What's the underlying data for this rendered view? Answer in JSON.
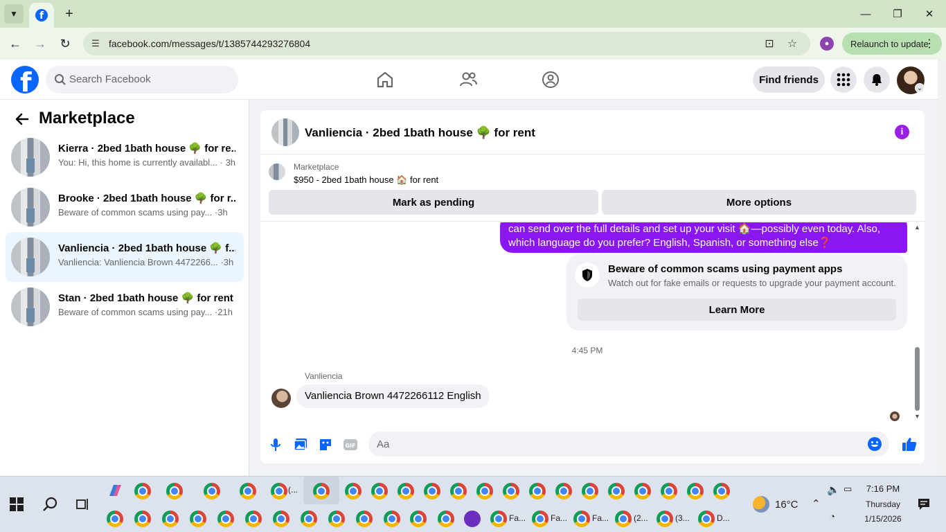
{
  "browser": {
    "url": "facebook.com/messages/t/1385744293276804",
    "relaunch_label": "Relaunch to update"
  },
  "fb": {
    "search_placeholder": "Search Facebook",
    "find_friends": "Find friends"
  },
  "sidebar": {
    "title": "Marketplace",
    "conversations": [
      {
        "name": "Kierra · 2bed 1bath house 🌳 for re...",
        "preview": "You: Hi, this home is currently availabl... · 3h"
      },
      {
        "name": "Brooke · 2bed 1bath house 🌳 for r...",
        "preview": "Beware of common scams using pay... ·3h"
      },
      {
        "name": "Vanliencia · 2bed 1bath house 🌳 f...",
        "preview": "Vanliencia: Vanliencia Brown 4472266... ·3h"
      },
      {
        "name": "Stan · 2bed 1bath house 🌳 for rent",
        "preview": "Beware of common scams using pay... ·21h"
      }
    ]
  },
  "chat": {
    "title": "Vanliencia · 2bed 1bath house 🌳 for rent",
    "marketplace_label": "Marketplace",
    "listing": "$950 - 2bed 1bath house 🏠 for rent",
    "mark_pending": "Mark as pending",
    "more_options": "More options",
    "sent_line1": "can send over the full details and set up your visit 🏠—possibly even today. Also,",
    "sent_line2": "which language do you prefer? English, Spanish, or something else❓",
    "scam_title": "Beware of common scams using payment apps",
    "scam_desc": "Watch out for fake emails or requests to upgrade your payment account.",
    "learn_more": "Learn More",
    "timestamp": "4:45 PM",
    "sender": "Vanliencia",
    "received": "Vanliencia Brown 4472266112 English",
    "compose_placeholder": "Aa"
  },
  "taskbar": {
    "tab_labels": [
      "(...",
      "Fa...",
      "Fa...",
      "Fa...",
      "(2...",
      "(3...",
      "D..."
    ],
    "temperature": "16°C",
    "time": "7:16 PM",
    "day": "Thursday",
    "date": "1/15/2026"
  }
}
